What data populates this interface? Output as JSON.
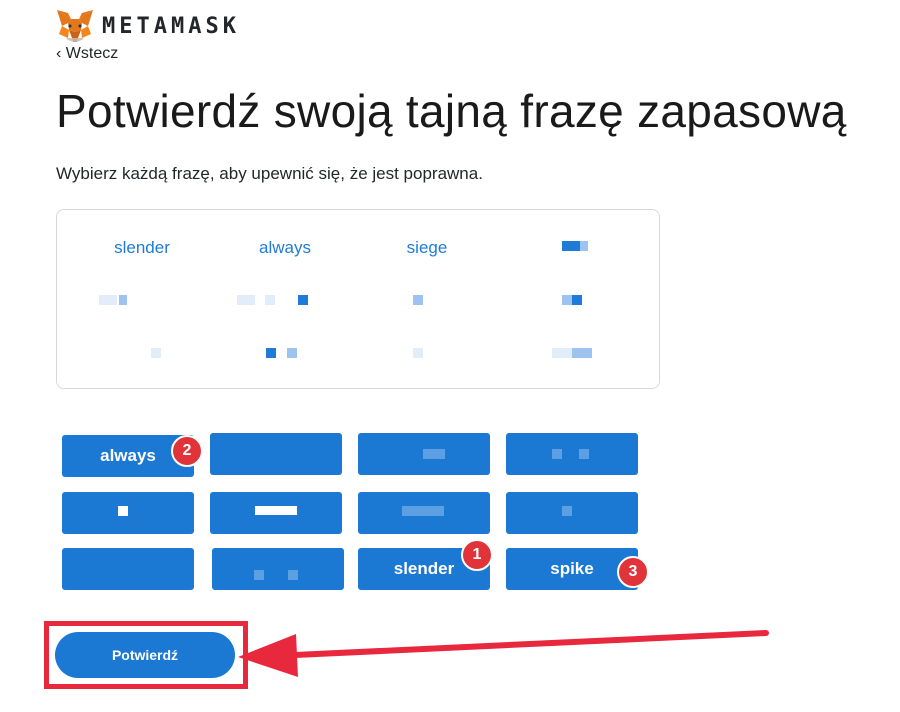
{
  "header": {
    "brand": "METAMASK",
    "back_label": "‹ Wstecz"
  },
  "page": {
    "title": "Potwierdź swoją tajną frazę zapasową",
    "subtitle": "Wybierz każdą frazę, aby upewnić się, że jest poprawna."
  },
  "phrase_slots": [
    "slender",
    "always",
    "siege",
    ""
  ],
  "word_buttons": [
    {
      "label": "always",
      "badge": "2"
    },
    {
      "label": "",
      "badge": ""
    },
    {
      "label": "",
      "badge": ""
    },
    {
      "label": "",
      "badge": ""
    },
    {
      "label": "",
      "badge": ""
    },
    {
      "label": "",
      "badge": ""
    },
    {
      "label": "",
      "badge": ""
    },
    {
      "label": "",
      "badge": ""
    },
    {
      "label": "",
      "badge": ""
    },
    {
      "label": "",
      "badge": ""
    },
    {
      "label": "slender",
      "badge": "1"
    },
    {
      "label": "spike",
      "badge": "3"
    }
  ],
  "confirm": {
    "label": "Potwierdź"
  },
  "colors": {
    "accent": "#1b78d3",
    "annotation": "#e8283d",
    "text": "#24272a"
  }
}
